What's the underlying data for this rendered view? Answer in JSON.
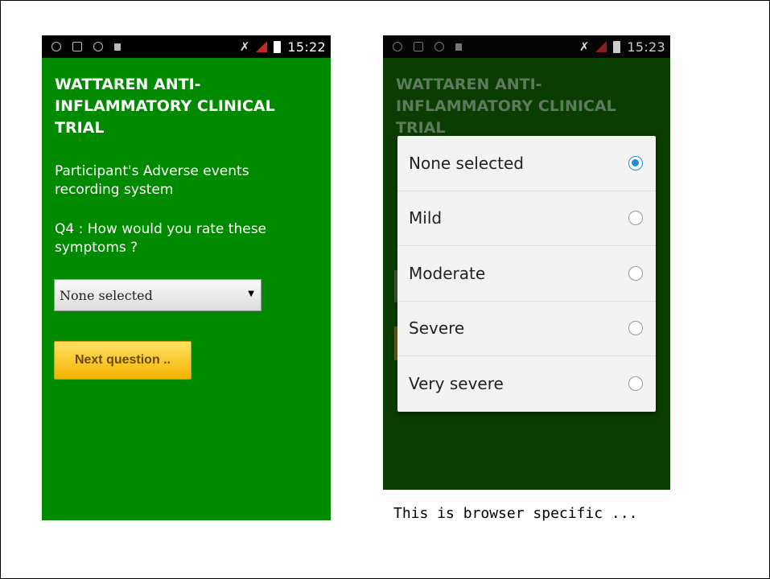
{
  "colors": {
    "phone1_background": "#008a00",
    "phone2_background": "#0a3d00",
    "button_gradient": "#f5b400",
    "radio_selected": "#1d8fd6"
  },
  "phone1": {
    "status": {
      "time": "15:22",
      "icons": [
        "voicemail-icon",
        "image-icon",
        "android-icon",
        "lock-icon",
        "mute-icon",
        "signal-icon",
        "battery-icon"
      ]
    },
    "title": "WATTAREN ANTI-INFLAMMATORY CLINICAL TRIAL",
    "subtitle": "Participant's Adverse events recording system",
    "question": "Q4 : How would you rate these symptoms ?",
    "select": {
      "value": "None selected"
    },
    "next_button": "Next question .."
  },
  "phone2": {
    "status": {
      "time": "15:23"
    },
    "title": "WATTAREN ANTI-INFLAMMATORY CLINICAL TRIAL",
    "options": [
      {
        "label": "None selected",
        "selected": true
      },
      {
        "label": "Mild",
        "selected": false
      },
      {
        "label": "Moderate",
        "selected": false
      },
      {
        "label": "Severe",
        "selected": false
      },
      {
        "label": "Very severe",
        "selected": false
      }
    ]
  },
  "caption": "This is browser specific ..."
}
